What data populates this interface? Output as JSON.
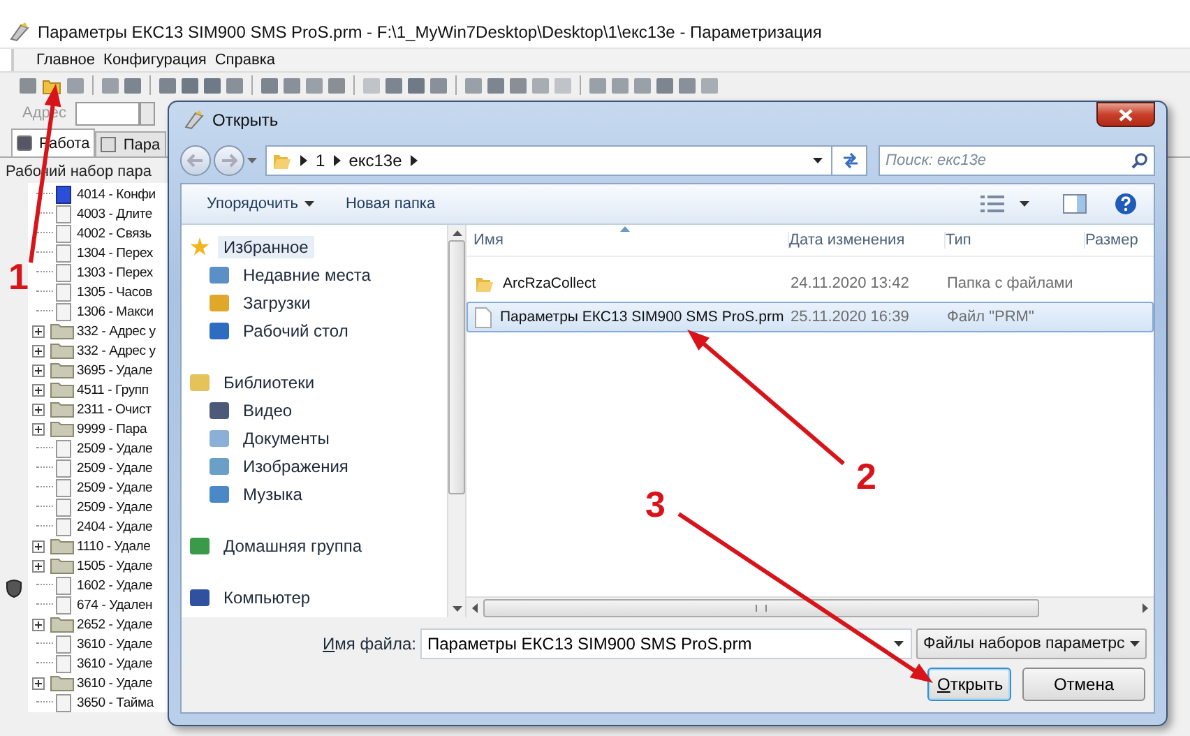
{
  "window": {
    "title": "Параметры ЕКС13 SIM900 SMS ProS.prm - F:\\1_MyWin7Desktop\\Desktop\\1\\екс13е - Параметризация"
  },
  "menu": [
    "Главное",
    "Конфигурация",
    "Справка"
  ],
  "address": {
    "label": "Адрес"
  },
  "tabs": [
    {
      "label": "Работа",
      "selected": true
    },
    {
      "label": "Пара",
      "selected": false
    }
  ],
  "group": {
    "title": "Рабочий набор пара"
  },
  "tree": [
    {
      "kind": "config",
      "label": "4014 - Конфи"
    },
    {
      "kind": "param",
      "label": "4003 - Длите"
    },
    {
      "kind": "param",
      "label": "4002 - Связь"
    },
    {
      "kind": "param",
      "label": "1304 - Перех"
    },
    {
      "kind": "param",
      "label": "1303 - Перех"
    },
    {
      "kind": "param",
      "label": "1305 - Часов"
    },
    {
      "kind": "param",
      "label": "1306 - Макси"
    },
    {
      "kind": "folder",
      "label": "332 - Адрес у"
    },
    {
      "kind": "folder",
      "label": "332 - Адрес у"
    },
    {
      "kind": "folder",
      "label": "3695 - Удале"
    },
    {
      "kind": "folder",
      "label": "4511 - Групп"
    },
    {
      "kind": "folder",
      "label": "2311 - Очист"
    },
    {
      "kind": "folder",
      "label": "9999 - Пара"
    },
    {
      "kind": "param",
      "label": "2509 - Удале"
    },
    {
      "kind": "param",
      "label": "2509 - Удале"
    },
    {
      "kind": "param",
      "label": "2509 - Удале"
    },
    {
      "kind": "param",
      "label": "2509 - Удале"
    },
    {
      "kind": "param",
      "label": "2404 - Удале"
    },
    {
      "kind": "folder",
      "label": "1110 - Удале"
    },
    {
      "kind": "folder",
      "label": "1505 - Удале"
    },
    {
      "kind": "param",
      "label": "1602 - Удале"
    },
    {
      "kind": "param",
      "label": "674 - Удален"
    },
    {
      "kind": "folder",
      "label": "2652 - Удале"
    },
    {
      "kind": "param",
      "label": "3610 - Удале"
    },
    {
      "kind": "param",
      "label": "3610 - Удале"
    },
    {
      "kind": "folder",
      "label": "3610 - Удале"
    },
    {
      "kind": "param",
      "label": "3650 - Тайма"
    }
  ],
  "dialog": {
    "title": "Открыть",
    "path": [
      "1",
      "екс13е"
    ],
    "search": {
      "placeholder": "Поиск: екс13е"
    },
    "commands": [
      {
        "label": "Упорядочить",
        "dropdown": true
      },
      {
        "label": "Новая папка",
        "dropdown": false
      }
    ],
    "nav": [
      {
        "kind": "group",
        "label": "Избранное",
        "selected": true
      },
      {
        "kind": "item",
        "label": "Недавние места",
        "selected": false
      },
      {
        "kind": "item",
        "label": "Загрузки",
        "selected": false
      },
      {
        "kind": "item",
        "label": "Рабочий стол",
        "selected": false
      },
      {
        "kind": "group",
        "label": "Библиотеки",
        "selected": false
      },
      {
        "kind": "item",
        "label": "Видео",
        "selected": false
      },
      {
        "kind": "item",
        "label": "Документы",
        "selected": false
      },
      {
        "kind": "item",
        "label": "Изображения",
        "selected": false
      },
      {
        "kind": "item",
        "label": "Музыка",
        "selected": false
      },
      {
        "kind": "group",
        "label": "Домашняя группа",
        "selected": false
      },
      {
        "kind": "group",
        "label": "Компьютер",
        "selected": false
      }
    ],
    "columns": [
      "Имя",
      "Дата изменения",
      "Тип",
      "Размер"
    ],
    "files": [
      {
        "kind": "folder",
        "name": "ArcRzaCollect",
        "date": "24.11.2020 13:42",
        "type": "Папка с файлами",
        "selected": false
      },
      {
        "kind": "file",
        "name": "Параметры ЕКС13 SIM900 SMS ProS.prm",
        "date": "25.11.2020 16:39",
        "type": "Файл \"PRM\"",
        "selected": true
      }
    ],
    "filename": {
      "label": "Имя файла:",
      "value": "Параметры ЕКС13 SIM900 SMS ProS.prm"
    },
    "filter": "Файлы наборов параметрс",
    "buttons": [
      {
        "label": "Открыть",
        "default": true
      },
      {
        "label": "Отмена",
        "default": false
      }
    ]
  },
  "annotations": [
    {
      "label": "1"
    },
    {
      "label": "2"
    },
    {
      "label": "3"
    }
  ]
}
